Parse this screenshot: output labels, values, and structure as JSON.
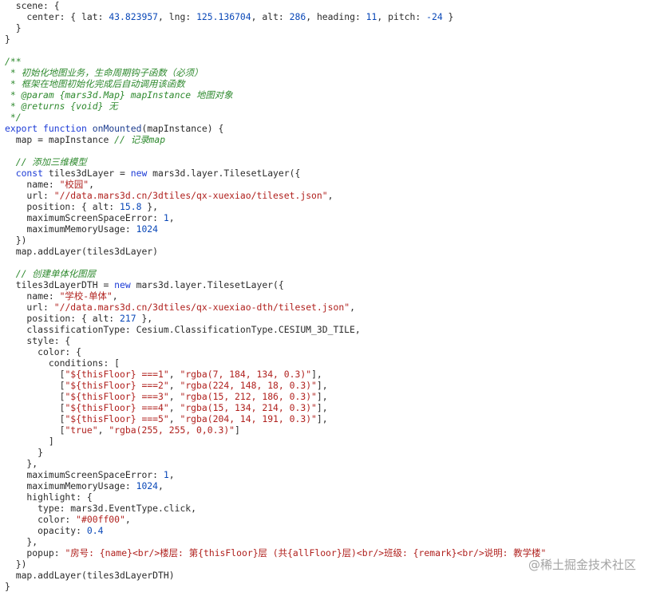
{
  "code_lines": [
    [
      [
        "pl",
        "  scene: {"
      ]
    ],
    [
      [
        "pl",
        "    center: { lat: "
      ],
      [
        "num",
        "43.823957"
      ],
      [
        "pl",
        ", lng: "
      ],
      [
        "num",
        "125.136704"
      ],
      [
        "pl",
        ", alt: "
      ],
      [
        "num",
        "286"
      ],
      [
        "pl",
        ", heading: "
      ],
      [
        "num",
        "11"
      ],
      [
        "pl",
        ", pitch: "
      ],
      [
        "num",
        "-24"
      ],
      [
        "pl",
        " }"
      ]
    ],
    [
      [
        "pl",
        "  }"
      ]
    ],
    [
      [
        "pl",
        "}"
      ]
    ],
    [
      [
        "pl",
        ""
      ]
    ],
    [
      [
        "cm",
        "/**"
      ]
    ],
    [
      [
        "cm",
        " * 初始化地图业务，生命周期钩子函数（必须）"
      ]
    ],
    [
      [
        "cm",
        " * 框架在地图初始化完成后自动调用该函数"
      ]
    ],
    [
      [
        "cm",
        " * @param {mars3d.Map} mapInstance 地图对象"
      ]
    ],
    [
      [
        "cm",
        " * @returns {void} 无"
      ]
    ],
    [
      [
        "cm",
        " */"
      ]
    ],
    [
      [
        "kw",
        "export"
      ],
      [
        "pl",
        " "
      ],
      [
        "kw",
        "function"
      ],
      [
        "pl",
        " "
      ],
      [
        "fn",
        "onMounted"
      ],
      [
        "pl",
        "(mapInstance) {"
      ]
    ],
    [
      [
        "pl",
        "  map = mapInstance "
      ],
      [
        "cm",
        "// 记录map"
      ]
    ],
    [
      [
        "pl",
        ""
      ]
    ],
    [
      [
        "pl",
        "  "
      ],
      [
        "cm",
        "// 添加三维模型"
      ]
    ],
    [
      [
        "pl",
        "  "
      ],
      [
        "kw",
        "const"
      ],
      [
        "pl",
        " tiles3dLayer = "
      ],
      [
        "kw",
        "new"
      ],
      [
        "pl",
        " mars3d.layer.TilesetLayer({"
      ]
    ],
    [
      [
        "pl",
        "    name: "
      ],
      [
        "str",
        "\"校园\""
      ],
      [
        "pl",
        ","
      ]
    ],
    [
      [
        "pl",
        "    url: "
      ],
      [
        "str",
        "\"//data.mars3d.cn/3dtiles/qx-xuexiao/tileset.json\""
      ],
      [
        "pl",
        ","
      ]
    ],
    [
      [
        "pl",
        "    position: { alt: "
      ],
      [
        "num",
        "15.8"
      ],
      [
        "pl",
        " },"
      ]
    ],
    [
      [
        "pl",
        "    maximumScreenSpaceError: "
      ],
      [
        "num",
        "1"
      ],
      [
        "pl",
        ","
      ]
    ],
    [
      [
        "pl",
        "    maximumMemoryUsage: "
      ],
      [
        "num",
        "1024"
      ]
    ],
    [
      [
        "pl",
        "  })"
      ]
    ],
    [
      [
        "pl",
        "  map.addLayer(tiles3dLayer)"
      ]
    ],
    [
      [
        "pl",
        ""
      ]
    ],
    [
      [
        "pl",
        "  "
      ],
      [
        "cm",
        "// 创建单体化图层"
      ]
    ],
    [
      [
        "pl",
        "  tiles3dLayerDTH = "
      ],
      [
        "kw",
        "new"
      ],
      [
        "pl",
        " mars3d.layer.TilesetLayer({"
      ]
    ],
    [
      [
        "pl",
        "    name: "
      ],
      [
        "str",
        "\"学校-单体\""
      ],
      [
        "pl",
        ","
      ]
    ],
    [
      [
        "pl",
        "    url: "
      ],
      [
        "str",
        "\"//data.mars3d.cn/3dtiles/qx-xuexiao-dth/tileset.json\""
      ],
      [
        "pl",
        ","
      ]
    ],
    [
      [
        "pl",
        "    position: { alt: "
      ],
      [
        "num",
        "217"
      ],
      [
        "pl",
        " },"
      ]
    ],
    [
      [
        "pl",
        "    classificationType: Cesium.ClassificationType.CESIUM_3D_TILE,"
      ]
    ],
    [
      [
        "pl",
        "    style: {"
      ]
    ],
    [
      [
        "pl",
        "      color: {"
      ]
    ],
    [
      [
        "pl",
        "        conditions: ["
      ]
    ],
    [
      [
        "pl",
        "          ["
      ],
      [
        "str",
        "\"${thisFloor} ===1\""
      ],
      [
        "pl",
        ", "
      ],
      [
        "str",
        "\"rgba(7, 184, 134, 0.3)\""
      ],
      [
        "pl",
        "],"
      ]
    ],
    [
      [
        "pl",
        "          ["
      ],
      [
        "str",
        "\"${thisFloor} ===2\""
      ],
      [
        "pl",
        ", "
      ],
      [
        "str",
        "\"rgba(224, 148, 18, 0.3)\""
      ],
      [
        "pl",
        "],"
      ]
    ],
    [
      [
        "pl",
        "          ["
      ],
      [
        "str",
        "\"${thisFloor} ===3\""
      ],
      [
        "pl",
        ", "
      ],
      [
        "str",
        "\"rgba(15, 212, 186, 0.3)\""
      ],
      [
        "pl",
        "],"
      ]
    ],
    [
      [
        "pl",
        "          ["
      ],
      [
        "str",
        "\"${thisFloor} ===4\""
      ],
      [
        "pl",
        ", "
      ],
      [
        "str",
        "\"rgba(15, 134, 214, 0.3)\""
      ],
      [
        "pl",
        "],"
      ]
    ],
    [
      [
        "pl",
        "          ["
      ],
      [
        "str",
        "\"${thisFloor} ===5\""
      ],
      [
        "pl",
        ", "
      ],
      [
        "str",
        "\"rgba(204, 14, 191, 0.3)\""
      ],
      [
        "pl",
        "],"
      ]
    ],
    [
      [
        "pl",
        "          ["
      ],
      [
        "str",
        "\"true\""
      ],
      [
        "pl",
        ", "
      ],
      [
        "str",
        "\"rgba(255, 255, 0,0.3)\""
      ],
      [
        "pl",
        "]"
      ]
    ],
    [
      [
        "pl",
        "        ]"
      ]
    ],
    [
      [
        "pl",
        "      }"
      ]
    ],
    [
      [
        "pl",
        "    },"
      ]
    ],
    [
      [
        "pl",
        "    maximumScreenSpaceError: "
      ],
      [
        "num",
        "1"
      ],
      [
        "pl",
        ","
      ]
    ],
    [
      [
        "pl",
        "    maximumMemoryUsage: "
      ],
      [
        "num",
        "1024"
      ],
      [
        "pl",
        ","
      ]
    ],
    [
      [
        "pl",
        "    highlight: {"
      ]
    ],
    [
      [
        "pl",
        "      type: mars3d.EventType.click,"
      ]
    ],
    [
      [
        "pl",
        "      color: "
      ],
      [
        "str",
        "\"#00ff00\""
      ],
      [
        "pl",
        ","
      ]
    ],
    [
      [
        "pl",
        "      opacity: "
      ],
      [
        "num",
        "0.4"
      ]
    ],
    [
      [
        "pl",
        "    },"
      ]
    ],
    [
      [
        "pl",
        "    popup: "
      ],
      [
        "str",
        "\"房号: {name}<br/>楼层: 第{thisFloor}层 (共{allFloor}层)<br/>班级: {remark}<br/>说明: 教学楼\""
      ]
    ],
    [
      [
        "pl",
        "  })"
      ]
    ],
    [
      [
        "pl",
        "  map.addLayer(tiles3dLayerDTH)"
      ]
    ],
    [
      [
        "pl",
        "}"
      ]
    ]
  ],
  "watermark": {
    "text": "@稀土掘金技术社区"
  },
  "colors": {
    "comment": "#2f8a2f",
    "keyword": "#1c3bd6",
    "string": "#b0211e",
    "number": "#0a48b8"
  }
}
